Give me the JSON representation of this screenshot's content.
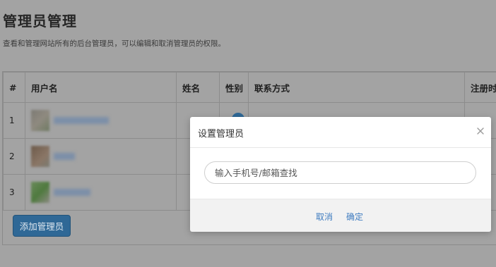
{
  "page": {
    "title": "管理员管理",
    "description": "查看和管理网站所有的后台管理员，可以编辑和取消管理员的权限。"
  },
  "table": {
    "headers": [
      "#",
      "用户名",
      "姓名",
      "性别",
      "联系方式",
      "注册时"
    ],
    "rows": [
      {
        "num": "1"
      },
      {
        "num": "2"
      },
      {
        "num": "3"
      }
    ]
  },
  "add_button": "添加管理员",
  "modal": {
    "title": "设置管理员",
    "search_placeholder": "输入手机号/邮箱查找",
    "cancel": "取消",
    "confirm": "确定"
  }
}
